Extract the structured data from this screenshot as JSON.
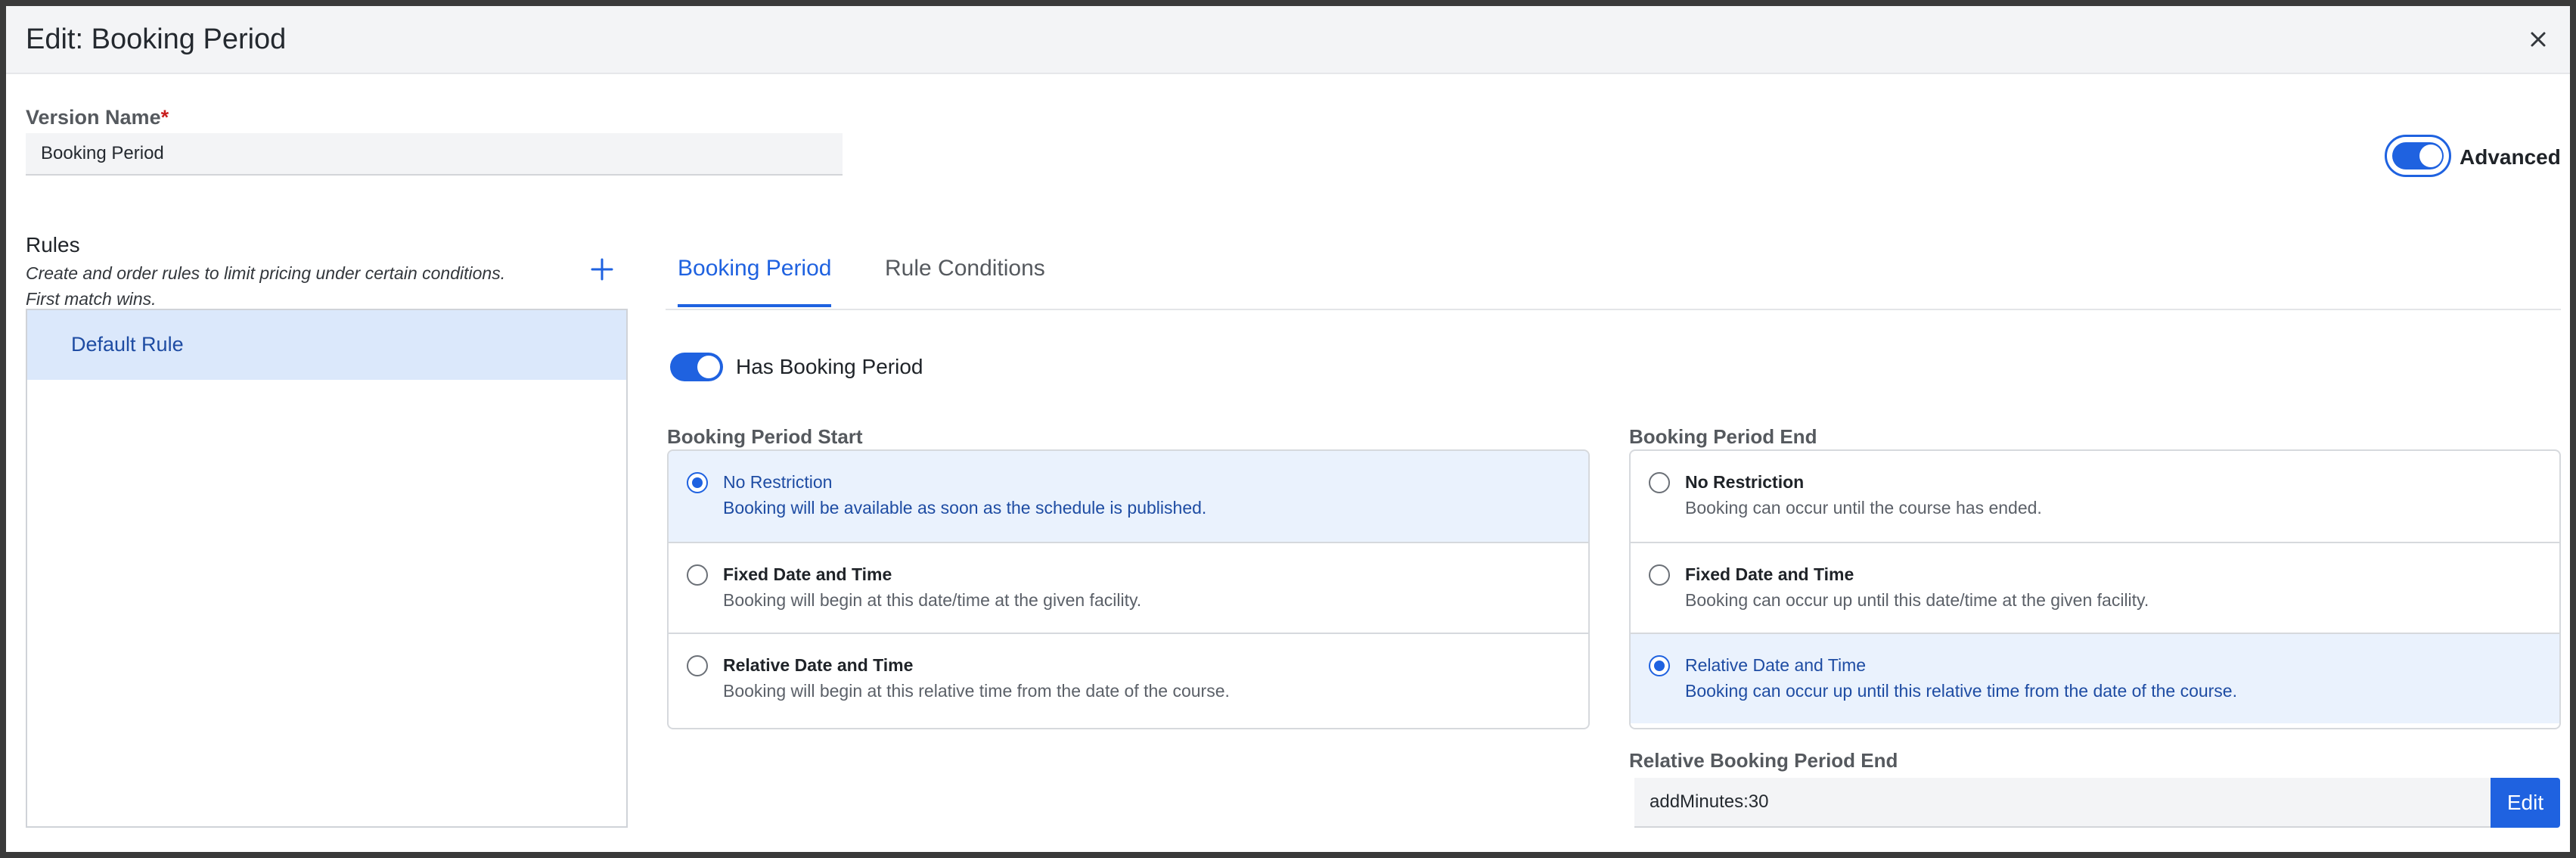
{
  "modal": {
    "title": "Edit: Booking Period"
  },
  "version": {
    "label": "Version Name",
    "required_mark": "*",
    "value": "Booking Period"
  },
  "advanced": {
    "label": "Advanced",
    "enabled": true
  },
  "rules": {
    "title": "Rules",
    "description_line1": "Create and order rules to limit pricing under certain conditions.",
    "description_line2": "First match wins.",
    "items": [
      {
        "label": "Default Rule",
        "selected": true
      }
    ]
  },
  "tabs": [
    {
      "label": "Booking Period",
      "active": true
    },
    {
      "label": "Rule Conditions",
      "active": false
    }
  ],
  "has_booking_period": {
    "label": "Has Booking Period",
    "enabled": true
  },
  "start": {
    "title": "Booking Period Start",
    "options": [
      {
        "title": "No Restriction",
        "desc": "Booking will be available as soon as the schedule is published.",
        "selected": true
      },
      {
        "title": "Fixed Date and Time",
        "desc": "Booking will begin at this date/time at the given facility.",
        "selected": false
      },
      {
        "title": "Relative Date and Time",
        "desc": "Booking will begin at this relative time from the date of the course.",
        "selected": false
      }
    ]
  },
  "end": {
    "title": "Booking Period End",
    "options": [
      {
        "title": "No Restriction",
        "desc": "Booking can occur until the course has ended.",
        "selected": false
      },
      {
        "title": "Fixed Date and Time",
        "desc": "Booking can occur up until this date/time at the given facility.",
        "selected": false
      },
      {
        "title": "Relative Date and Time",
        "desc": "Booking can occur up until this relative time from the date of the course.",
        "selected": true
      }
    ]
  },
  "relative_end": {
    "label": "Relative Booking Period End",
    "value": "addMinutes:30",
    "edit_label": "Edit"
  },
  "colors": {
    "accent": "#1f62e0",
    "selected_bg": "#eaf2fd",
    "rule_selected_bg": "#dbe8fb"
  }
}
